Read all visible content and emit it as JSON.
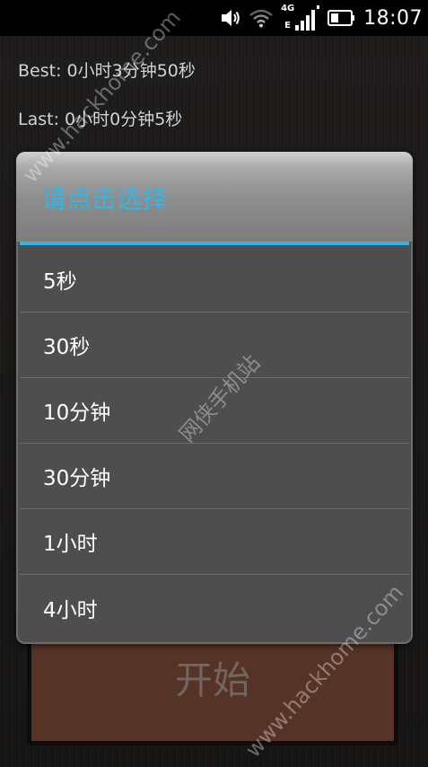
{
  "status_bar": {
    "time": "18:07",
    "network_type": "4G",
    "network_sub": "E",
    "icons": [
      "volume-icon",
      "wifi-icon",
      "signal-icon",
      "battery-icon"
    ]
  },
  "records": {
    "best": "Best: 0小时3分钟50秒",
    "last": "Last: 0小时0分钟5秒"
  },
  "start_button": {
    "label": "开始"
  },
  "dialog": {
    "title": "请点击选择",
    "options": [
      "5秒",
      "30秒",
      "10分钟",
      "30分钟",
      "1小时",
      "4小时"
    ]
  },
  "watermarks": {
    "site": "www.hackhome.com",
    "brand": "网侠手机站"
  },
  "colors": {
    "accent": "#33b5e5",
    "start_button": "#6a3f30",
    "dialog_bg": "#4e4e4e"
  }
}
